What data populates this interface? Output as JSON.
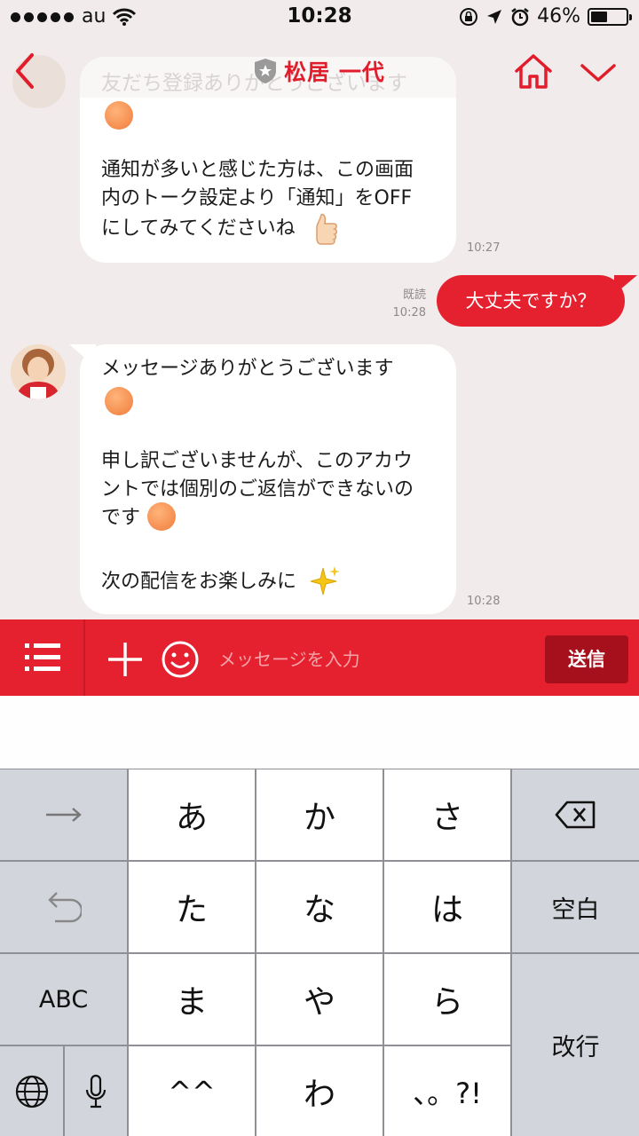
{
  "status_bar": {
    "carrier": "au",
    "time": "10:28",
    "battery": "46%"
  },
  "header": {
    "title": "松居 一代",
    "faded_preview": "友だち登録ありがとうございます"
  },
  "messages": {
    "bubble1": {
      "line1": "通知が多いと感じた方は、この画面",
      "line2": "内のトーク設定より「通知」をOFF",
      "line3": "にしてみてくださいね",
      "time": "10:27"
    },
    "sent": {
      "text": "大丈夫ですか？",
      "read": "既読",
      "time": "10:28"
    },
    "bubble2": {
      "line1": "メッセージありがとうございます",
      "line2": "申し訳ございませんが、このアカウ",
      "line3": "ントでは個別のご返信ができないの",
      "line4": "です",
      "line5": "次の配信をお楽しみに",
      "time": "10:28"
    }
  },
  "input_bar": {
    "placeholder": "メッセージを入力",
    "send_label": "送信"
  },
  "keyboard": {
    "row1": [
      "あ",
      "か",
      "さ"
    ],
    "row2": [
      "た",
      "な",
      "は"
    ],
    "row3": [
      "ま",
      "や",
      "ら"
    ],
    "row4": [
      "^^",
      "わ",
      "、。?!"
    ],
    "abc": "ABC",
    "space": "空白",
    "return": "改行"
  },
  "colors": {
    "accent": "#e6212f",
    "send_button": "#a5101c",
    "chat_bg": "#f1eceb"
  }
}
